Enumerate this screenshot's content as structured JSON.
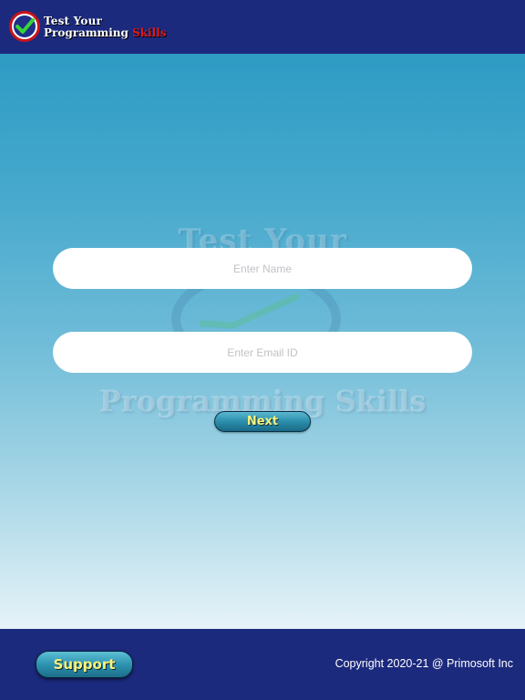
{
  "header": {
    "logo_line1": "Test Your",
    "logo_line2_prefix": "Programming ",
    "logo_line2_highlight": "Skills",
    "logo_icon": "checkmark-badge-icon"
  },
  "main": {
    "watermark_top": "Test Your",
    "watermark_bottom": "Programming Skills",
    "name_field": {
      "placeholder": "Enter Name",
      "value": ""
    },
    "email_field": {
      "placeholder": "Enter Email ID",
      "value": ""
    },
    "next_label": "Next"
  },
  "footer": {
    "support_label": "Support",
    "copyright": "Copyright 2020-21 @ Primosoft Inc"
  },
  "colors": {
    "header_bg": "#1c2a7d",
    "button_text": "#f6f27a",
    "skills_red": "#e01818"
  }
}
